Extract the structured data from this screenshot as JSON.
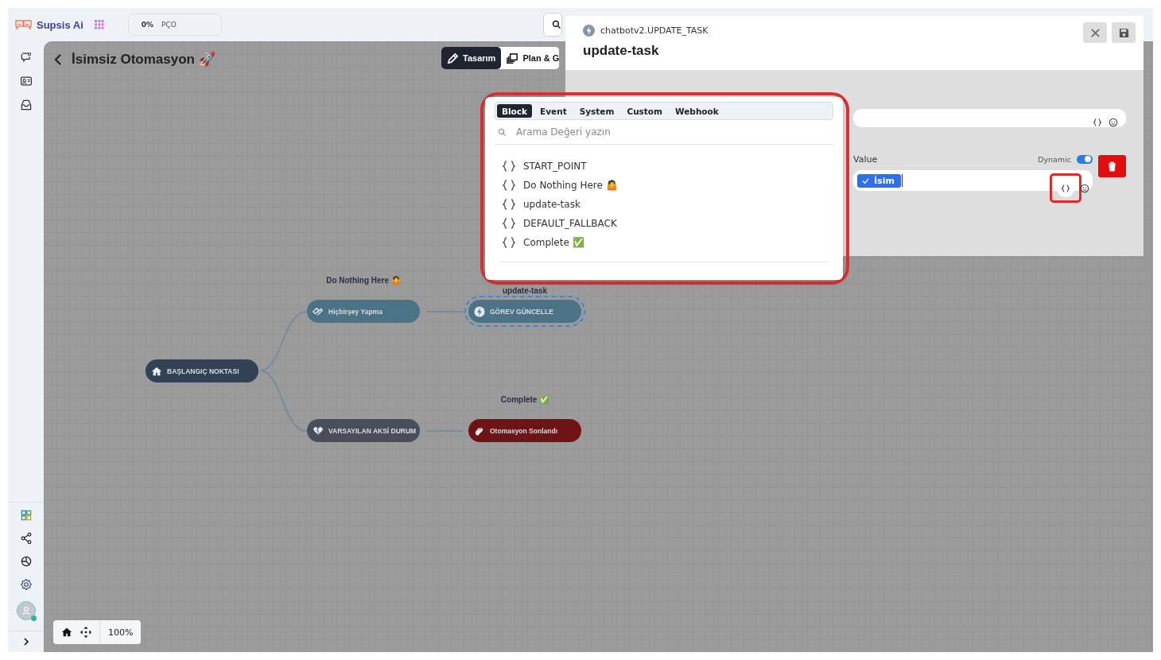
{
  "app": {
    "brand": "Supsis Ai",
    "usage_percent": "0%",
    "usage_label": "PÇO"
  },
  "flow": {
    "title": "İsimsiz Otomasyon 🚀",
    "view_tabs": [
      {
        "label": "Tasarım",
        "selected": true
      },
      {
        "label": "Plan & G",
        "selected": false
      }
    ]
  },
  "nodes": [
    {
      "kind": "start",
      "label": "BAŞLANGIÇ NOKTASI",
      "selected": false
    },
    {
      "kind": "action",
      "label": "Hiçbirşey Yapma",
      "caption": "Do Nothing Here 🤷",
      "selected": false
    },
    {
      "kind": "update",
      "label": "GÖREV GÜNCELLE",
      "caption": "update-task",
      "selected": true
    },
    {
      "kind": "fallback",
      "label": "VARSAYILAN AKSİ DURUM",
      "selected": false
    },
    {
      "kind": "end",
      "label": "Otomasyon Sonlandı",
      "caption": "Complete ✅",
      "selected": false
    }
  ],
  "zoom": "100%",
  "panel": {
    "subtitle": "chatbotv2.UPDATE_TASK",
    "title": "update-task",
    "value_label": "Value",
    "dynamic_label": "Dynamic",
    "dynamic_on": true,
    "value_chip": "İsim"
  },
  "picker": {
    "tabs": [
      {
        "label": "Block",
        "selected": true
      },
      {
        "label": "Event",
        "selected": false
      },
      {
        "label": "System",
        "selected": false
      },
      {
        "label": "Custom",
        "selected": false
      },
      {
        "label": "Webhook",
        "selected": false
      }
    ],
    "search_placeholder": "Arama Değeri yazın",
    "items": [
      "START_POINT",
      "Do Nothing Here 🤷",
      "update-task",
      "DEFAULT_FALLBACK",
      "Complete ✅"
    ]
  }
}
